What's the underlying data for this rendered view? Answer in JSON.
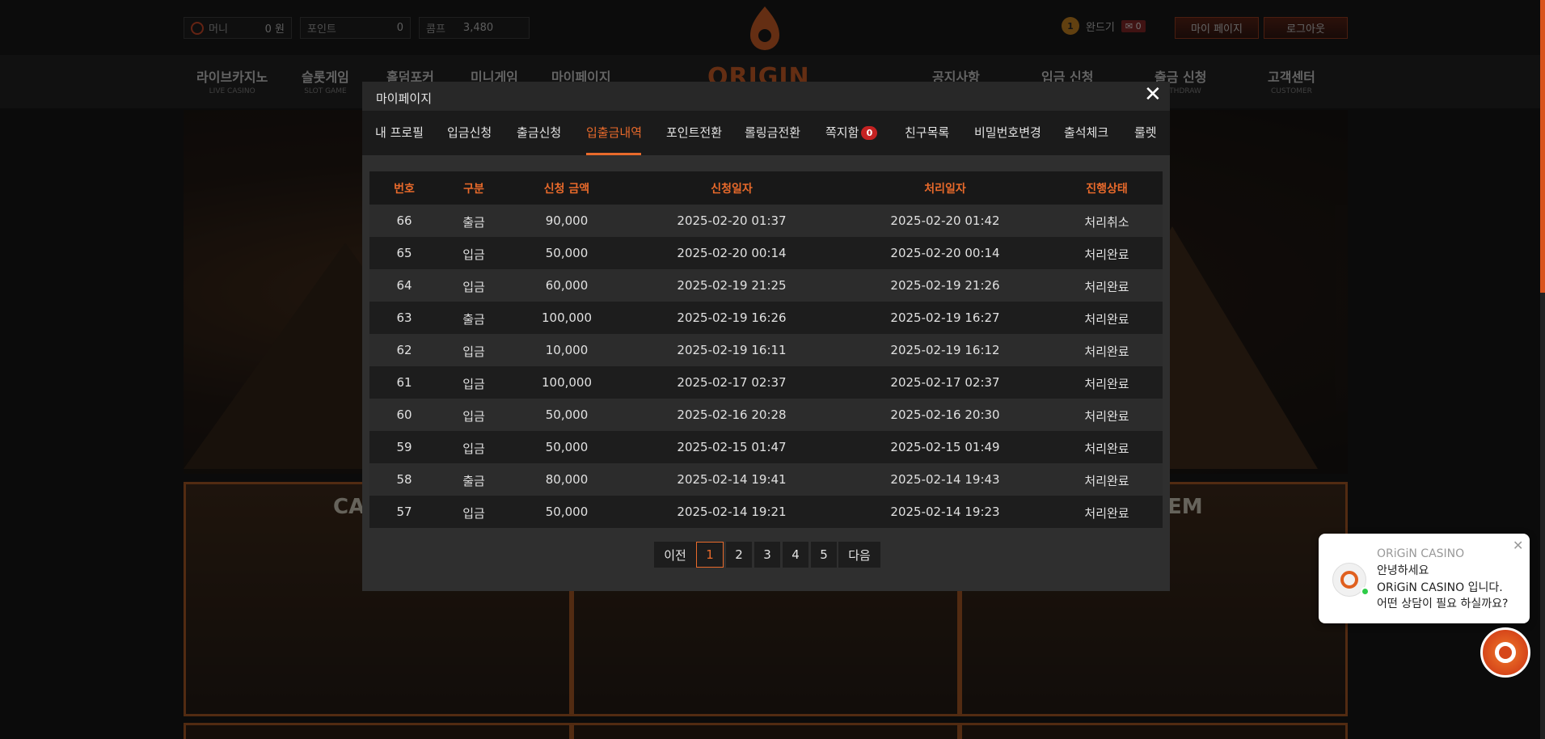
{
  "site": {
    "wallet": [
      {
        "label": "머니",
        "value": "0 원"
      },
      {
        "label": "포인트",
        "value": "0"
      },
      {
        "label": "콤프",
        "value": "3,480"
      }
    ],
    "user": {
      "level": "1",
      "name": "완드기",
      "messages": "0"
    },
    "buttons": {
      "mypage": "마이 페이지",
      "logout": "로그아웃"
    },
    "nav": [
      {
        "ko": "라이브카지노",
        "en": "LIVE CASINO"
      },
      {
        "ko": "슬롯게임",
        "en": "SLOT GAME"
      },
      {
        "ko": "홀덤포커",
        "en": ""
      },
      {
        "ko": "미니게임",
        "en": ""
      },
      {
        "ko": "마이페이지",
        "en": ""
      },
      {
        "ko": "공지사항",
        "en": ""
      },
      {
        "ko": "입금 신청",
        "en": ""
      },
      {
        "ko": "출금 신청",
        "en": "WITHDRAW"
      },
      {
        "ko": "고객센터",
        "en": "CUSTOMER"
      }
    ],
    "logo_text": "ORIGIN",
    "cards": [
      {
        "title": "CA"
      },
      {
        "title": ""
      },
      {
        "title": "EM"
      }
    ]
  },
  "modal": {
    "title": "마이페이지",
    "close": "✕",
    "tabs": [
      {
        "label": "내 프로필"
      },
      {
        "label": "입금신청"
      },
      {
        "label": "출금신청"
      },
      {
        "label": "입출금내역"
      },
      {
        "label": "포인트전환"
      },
      {
        "label": "롤링금전환"
      },
      {
        "label": "쪽지함"
      },
      {
        "label": "친구목록"
      },
      {
        "label": "비밀번호변경"
      },
      {
        "label": "출석체크"
      },
      {
        "label": "룰렛"
      }
    ],
    "note_count": "0",
    "active_tab": "입출금내역",
    "table": {
      "headers": [
        "번호",
        "구분",
        "신청 금액",
        "신청일자",
        "처리일자",
        "진행상태"
      ],
      "rows": [
        [
          "66",
          "출금",
          "90,000",
          "2025-02-20 01:37",
          "2025-02-20 01:42",
          "처리취소"
        ],
        [
          "65",
          "입금",
          "50,000",
          "2025-02-20 00:14",
          "2025-02-20 00:14",
          "처리완료"
        ],
        [
          "64",
          "입금",
          "60,000",
          "2025-02-19 21:25",
          "2025-02-19 21:26",
          "처리완료"
        ],
        [
          "63",
          "출금",
          "100,000",
          "2025-02-19 16:26",
          "2025-02-19 16:27",
          "처리완료"
        ],
        [
          "62",
          "입금",
          "10,000",
          "2025-02-19 16:11",
          "2025-02-19 16:12",
          "처리완료"
        ],
        [
          "61",
          "입금",
          "100,000",
          "2025-02-17 02:37",
          "2025-02-17 02:37",
          "처리완료"
        ],
        [
          "60",
          "입금",
          "50,000",
          "2025-02-16 20:28",
          "2025-02-16 20:30",
          "처리완료"
        ],
        [
          "59",
          "입금",
          "50,000",
          "2025-02-15 01:47",
          "2025-02-15 01:49",
          "처리완료"
        ],
        [
          "58",
          "출금",
          "80,000",
          "2025-02-14 19:41",
          "2025-02-14 19:43",
          "처리완료"
        ],
        [
          "57",
          "입금",
          "50,000",
          "2025-02-14 19:21",
          "2025-02-14 19:23",
          "처리완료"
        ]
      ]
    },
    "pagination": {
      "prev": "이전",
      "pages": [
        "1",
        "2",
        "3",
        "4",
        "5"
      ],
      "current": "1",
      "next": "다음"
    }
  },
  "chat": {
    "name": "ORiGiN CASINO",
    "lines": [
      "안녕하세요",
      "ORiGiN CASINO 입니다.",
      "어떤 상담이 필요 하실까요?"
    ],
    "close": "✕"
  },
  "colors": {
    "accent": "#e96a2b",
    "badge_red": "#c42222",
    "online_green": "#2ecc48"
  }
}
